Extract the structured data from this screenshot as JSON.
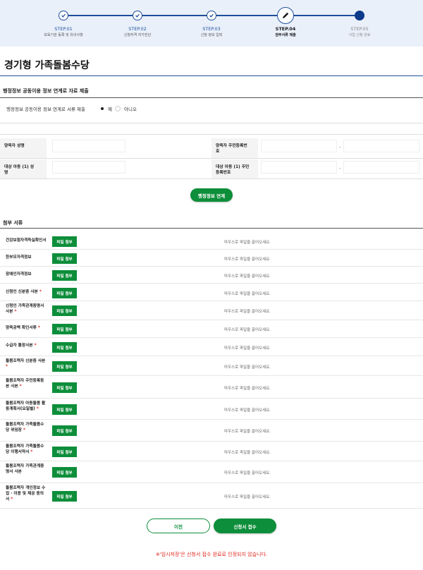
{
  "stepper": {
    "steps": [
      {
        "no": "STEP.01",
        "label": "보육기관 등록 및 유의사항"
      },
      {
        "no": "STEP.02",
        "label": "신청자격 자가진단"
      },
      {
        "no": "STEP.03",
        "label": "신청 정보 입력"
      },
      {
        "no": "STEP.04",
        "label": "첨부서류 제출"
      },
      {
        "no": "STEP.05",
        "label": "사업 신청 완료"
      }
    ],
    "icons": {
      "done": "check-icon",
      "current": "pencil-icon",
      "pending": "dot-icon"
    },
    "colors": {
      "line": "#1f4f9a",
      "background": "#e9f0fa"
    }
  },
  "page": {
    "title": "경기형 가족돌봄수당"
  },
  "admin_info": {
    "section_title": "행정정보 공동이용 정보 연계로 자료 제출",
    "consent_label": "행정정보 공동이용 정보 연계로 서류 제출",
    "option_yes": "예",
    "option_no": "아니오",
    "parent_name_label": "양육자 성명",
    "parent_id_label": "양육자 주민등록번호",
    "child_name_label": "대상 아동 (1) 성명",
    "child_id_label": "대상 아동 (1) 주민등록번호",
    "id_separator": "-",
    "link_button": "행정정보 연계"
  },
  "attachments": {
    "section_title": "첨부 서류",
    "file_button": "파일 첨부",
    "drop_text": "마우스로 파일을 끌어오세요.",
    "required_mark": "*",
    "items": [
      {
        "label": "건강보험자격득실확인서",
        "required": false
      },
      {
        "label": "한부모자격정보",
        "required": false
      },
      {
        "label": "장애인자격정보",
        "required": false
      },
      {
        "label": "신청인 신분증 사본",
        "required": true
      },
      {
        "label": "신청인 가족관계증명서 사본",
        "required": true
      },
      {
        "label": "양육공백 확인서류",
        "required": true
      },
      {
        "label": "수급자 통장사본",
        "required": true
      },
      {
        "label": "돌봄조력자 신분증 사본",
        "required": true
      },
      {
        "label": "돌봄조력자 주민등록등본 사본",
        "required": true
      },
      {
        "label": "돌봄조력자 아동돌봄 활동계획서(요일별)",
        "required": true
      },
      {
        "label": "돌봄조력자 가족돌봄수당 위임장",
        "required": true
      },
      {
        "label": "돌봄조력자 가족돌봄수당 이행서약서",
        "required": true
      },
      {
        "label": "돌봄조력자 가족관계증명서 사본",
        "required": false
      },
      {
        "label": "돌봄조력자 개인정보 수집 · 이용 및 제공 동의서",
        "required": true
      }
    ],
    "colors": {
      "button": "#0d8e3a",
      "required": "#e0261b"
    }
  },
  "footer": {
    "prev_button": "이전",
    "submit_button": "신청서 접수",
    "notice": "※'임시저장'은 신청서 접수 완료로 인정되지 않습니다."
  }
}
